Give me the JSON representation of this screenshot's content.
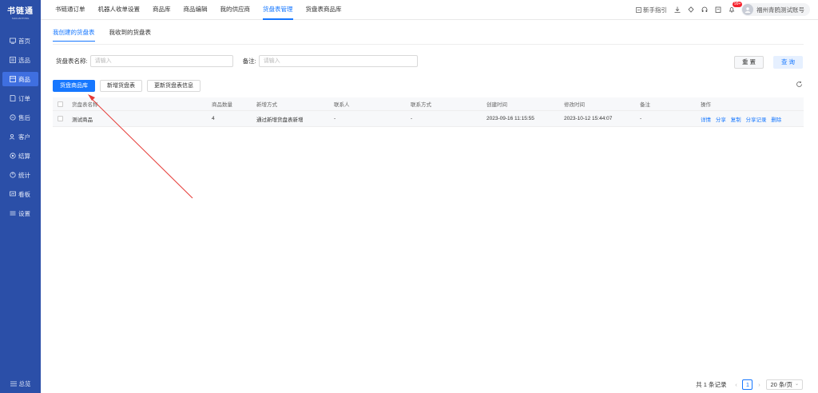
{
  "app": {
    "logo_title": "书链通",
    "logo_sub": "SHULIANTONG"
  },
  "sidebar": {
    "items": [
      {
        "label": "首页",
        "icon": "home-icon"
      },
      {
        "label": "选品",
        "icon": "select-icon"
      },
      {
        "label": "商品",
        "icon": "goods-icon",
        "active": true
      },
      {
        "label": "订单",
        "icon": "order-icon"
      },
      {
        "label": "售后",
        "icon": "aftersale-icon"
      },
      {
        "label": "客户",
        "icon": "customer-icon"
      },
      {
        "label": "结算",
        "icon": "settle-icon"
      },
      {
        "label": "统计",
        "icon": "stats-icon"
      },
      {
        "label": "看板",
        "icon": "board-icon"
      },
      {
        "label": "设置",
        "icon": "settings-icon"
      }
    ],
    "collapse_label": "总览"
  },
  "topbar": {
    "tabs": [
      "书链通订单",
      "机器人收单设置",
      "商品库",
      "商品编辑",
      "我的供应商",
      "货盘表管理",
      "货盘表商品库"
    ],
    "active_tab": 5,
    "guide_label": "新手指引",
    "badge_count": "99+",
    "user_name": "福州青鸥测试账号"
  },
  "subtabs": [
    "我创建的货盘表",
    "我收到的货盘表"
  ],
  "filters": {
    "name_label": "货盘表名称:",
    "name_placeholder": "请输入",
    "remark_label": "备注:",
    "remark_placeholder": "请输入",
    "reset_label": "重 置",
    "query_label": "查 询"
  },
  "actions": {
    "primary_label": "货盘商品库",
    "add_label": "新增货盘表",
    "update_label": "更新货盘表信息"
  },
  "table": {
    "headers": [
      "货盘表名称",
      "商品数量",
      "新增方式",
      "联系人",
      "联系方式",
      "创建时间",
      "修改时间",
      "备注",
      "操作"
    ],
    "rows": [
      {
        "name": "测试商品",
        "count": "4",
        "method": "通过新增货盘表新增",
        "contact": "-",
        "phone": "-",
        "created": "2023-09-16 11:15:55",
        "modified": "2023-10-12 15:44:07",
        "remark": "-",
        "ops": [
          "详情",
          "分享",
          "复制",
          "分享记录",
          "删除"
        ]
      }
    ]
  },
  "pagination": {
    "total_text": "共 1 条记录",
    "current_page": "1",
    "page_size": "20 条/页"
  },
  "colors": {
    "sidebar": "#2b4fa8",
    "accent": "#1677ff",
    "annotation_arrow": "#e53935"
  }
}
